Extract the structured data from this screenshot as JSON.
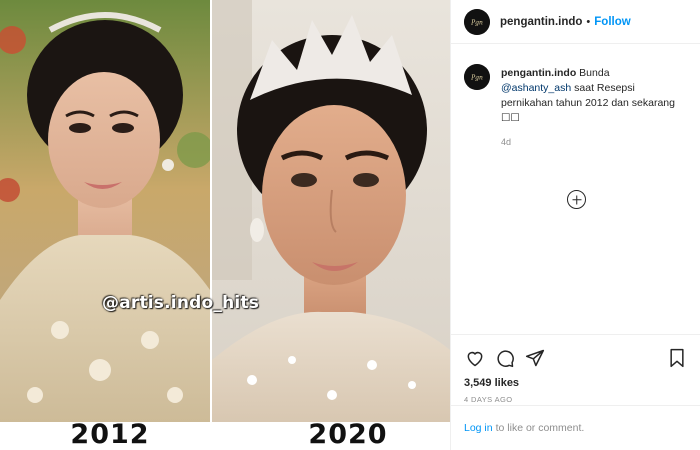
{
  "post": {
    "watermark": "@artis.indo_hits",
    "years": [
      "2012",
      "2020"
    ]
  },
  "header": {
    "username": "pengantin.indo",
    "separator": "•",
    "follow_label": "Follow"
  },
  "caption": {
    "username": "pengantin.indo",
    "text_before": "Bunda ",
    "mention": "@ashanty_ash",
    "text_after": " saat Resepsi pernikahan tahun 2012 dan sekarang ☐☐",
    "time": "4d"
  },
  "actions": {
    "icons": [
      "heart-icon",
      "comment-icon",
      "share-icon",
      "bookmark-icon"
    ],
    "likes": "3,549 likes",
    "date": "4 DAYS AGO"
  },
  "login": {
    "link_label": "Log in",
    "rest": "to like or comment."
  },
  "colors": {
    "accent": "#0095f6",
    "mention": "#00376b",
    "muted": "#8e8e8e",
    "border": "#efefef"
  }
}
